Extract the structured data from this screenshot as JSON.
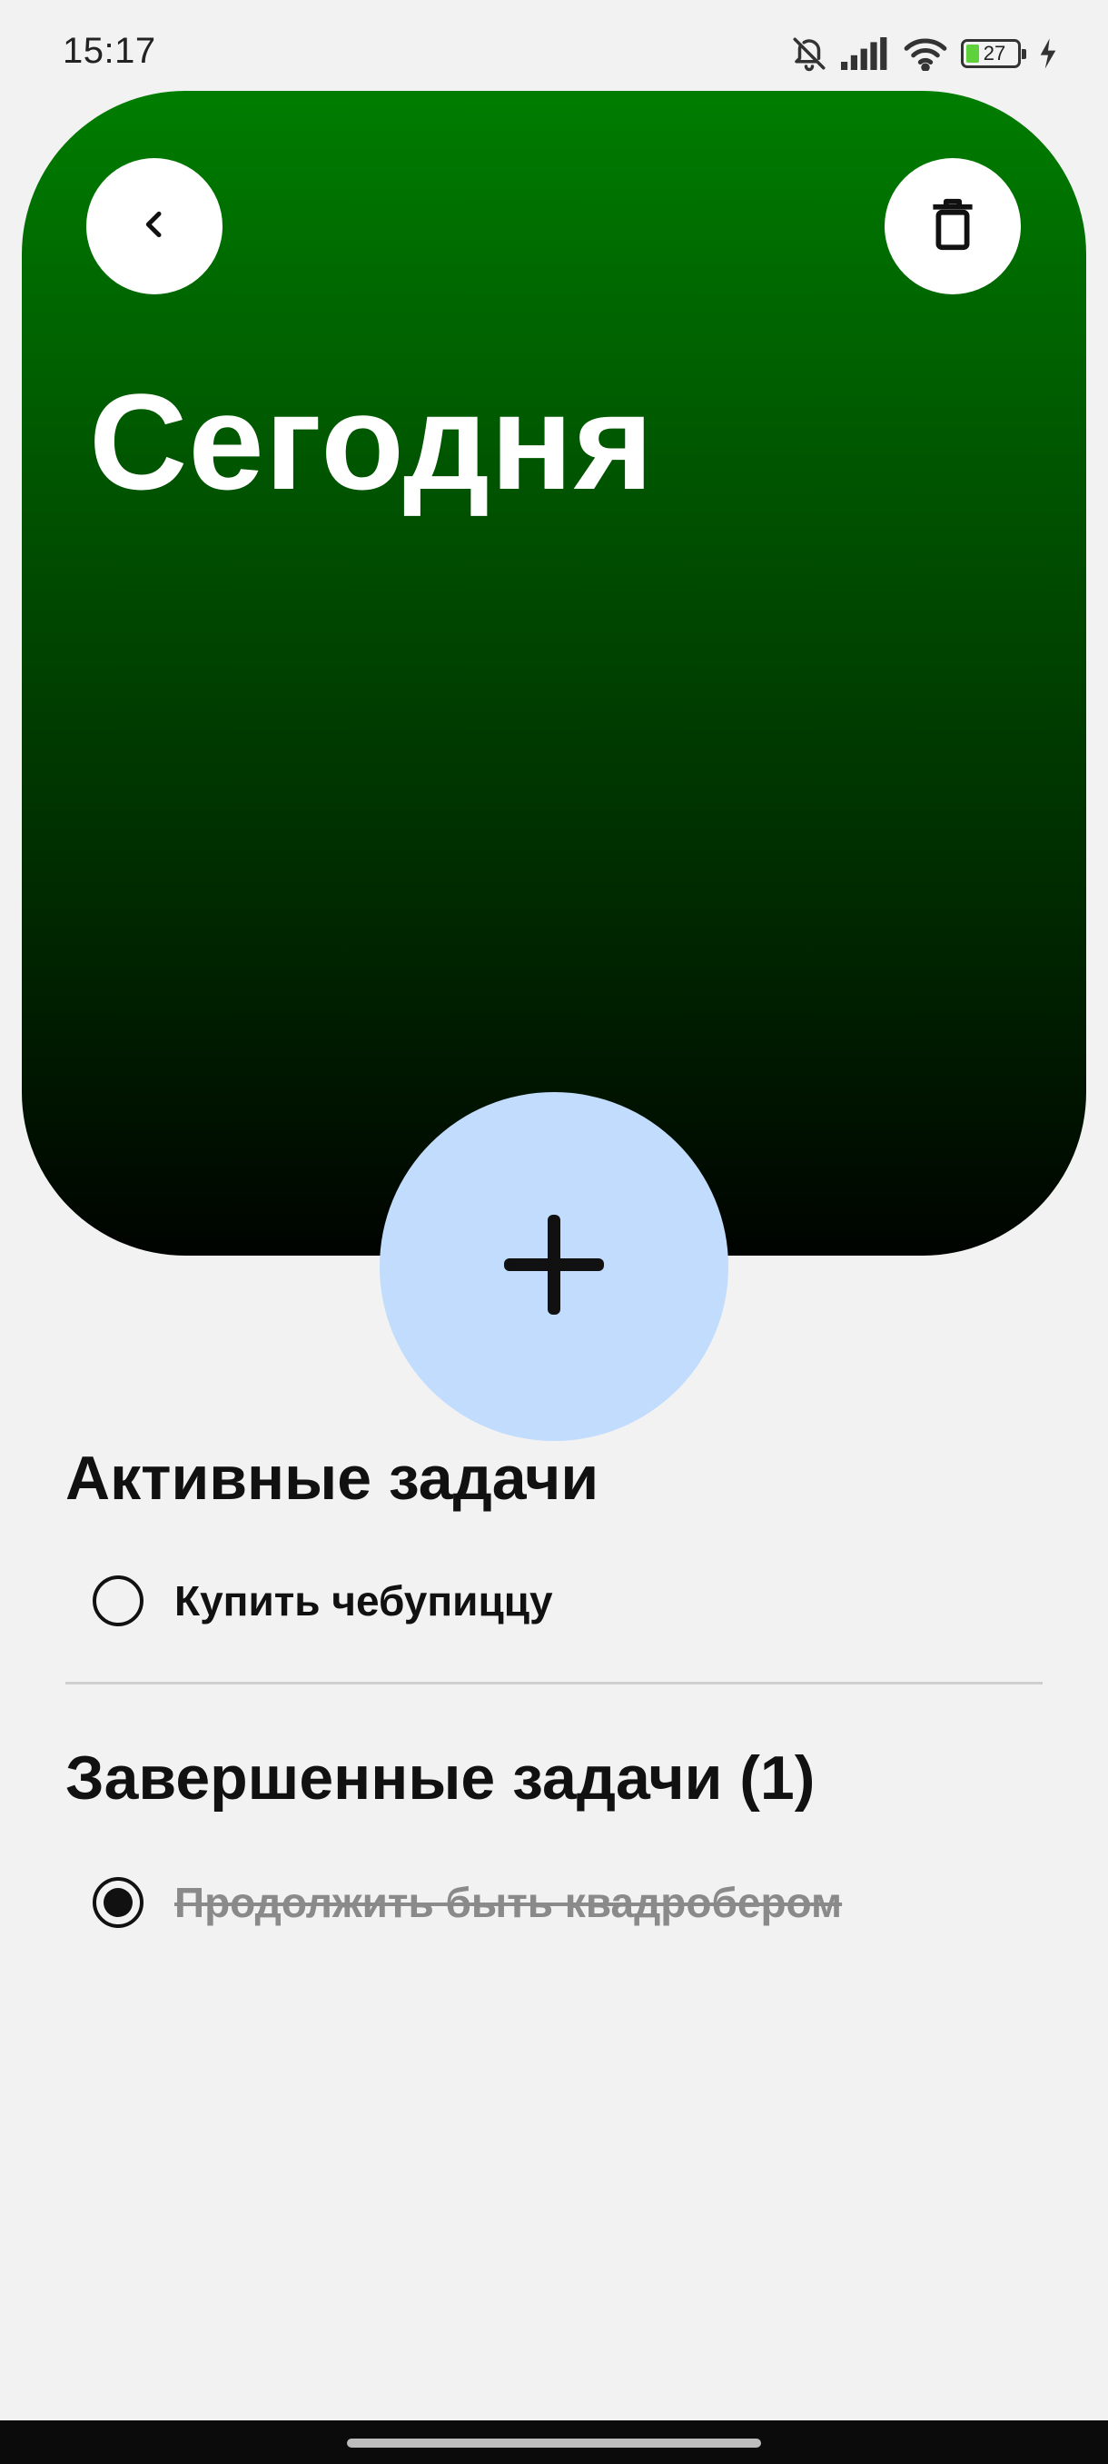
{
  "status_bar": {
    "time": "15:17",
    "battery_level": "27",
    "icons": [
      "bell-off-icon",
      "signal-icon",
      "wifi-icon",
      "battery-icon",
      "charging-bolt-icon"
    ]
  },
  "header": {
    "title": "Сегодня",
    "back_icon": "chevron-left-icon",
    "delete_icon": "trash-icon",
    "gradient_colors": [
      "#007d00",
      "#000300"
    ]
  },
  "fab": {
    "icon": "plus-icon",
    "color": "#c2dcfd"
  },
  "active_section": {
    "title": "Активные задачи",
    "tasks": [
      {
        "label": "Купить чебупиццу",
        "checked": false
      }
    ]
  },
  "done_section": {
    "title": "Завершенные задачи (1)",
    "tasks": [
      {
        "label": "Продолжить быть квадробером",
        "checked": true
      }
    ]
  }
}
